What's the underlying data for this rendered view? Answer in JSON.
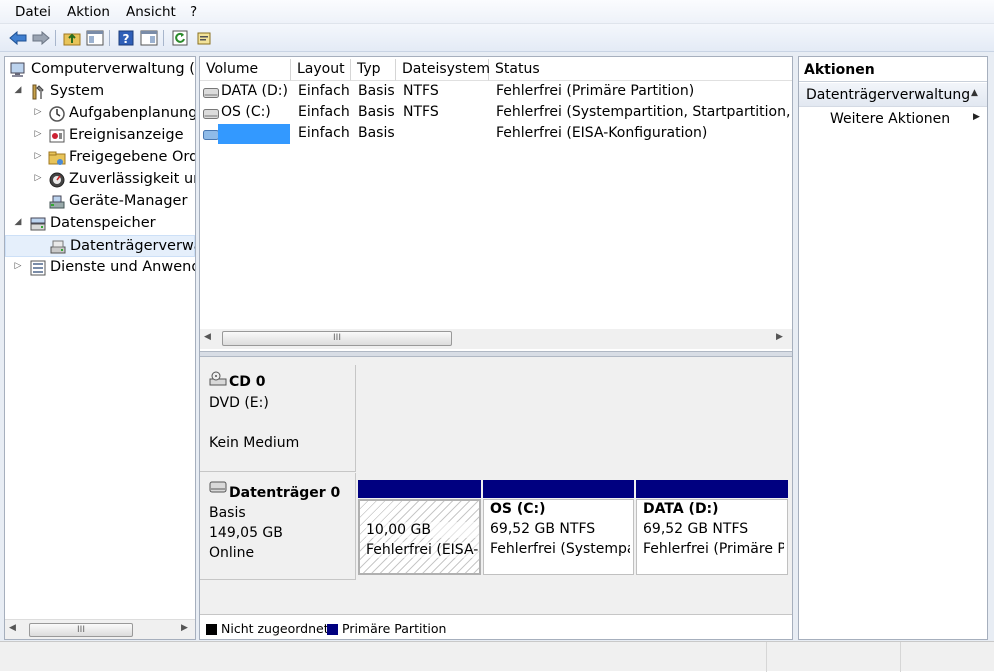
{
  "menu": [
    "Datei",
    "Aktion",
    "Ansicht",
    "?"
  ],
  "toolbar": {
    "icons": [
      "back-icon",
      "forward-icon",
      "up-folder-icon",
      "show-hide-tree-icon",
      "help-icon",
      "show-hide-action-icon",
      "refresh-icon",
      "properties-icon"
    ]
  },
  "tree": {
    "root": "Computerverwaltung (Lo",
    "system": "System",
    "aufgaben": "Aufgabenplanung",
    "ereignis": "Ereignisanzeige",
    "freigegeben": "Freigegebene Ordr",
    "zuverl": "Zuverlässigkeit unc",
    "geraete": "Geräte-Manager",
    "datenspeicher": "Datenspeicher",
    "datentraeger": "Datenträgerverwal",
    "dienste": "Dienste und Anwendu"
  },
  "list": {
    "headers": [
      "Volume",
      "Layout",
      "Typ",
      "Dateisystem",
      "Status"
    ],
    "rows": [
      {
        "volume": "DATA (D:)",
        "layout": "Einfach",
        "typ": "Basis",
        "fs": "NTFS",
        "status": "Fehlerfrei (Primäre Partition)"
      },
      {
        "volume": "OS (C:)",
        "layout": "Einfach",
        "typ": "Basis",
        "fs": "NTFS",
        "status": "Fehlerfrei (Systempartition, Startpartition, Aus"
      },
      {
        "volume": "",
        "layout": "Einfach",
        "typ": "Basis",
        "fs": "",
        "status": "Fehlerfrei (EISA-Konfiguration)"
      }
    ],
    "scroll_mark": "III"
  },
  "disks": {
    "cd": {
      "name": "CD 0",
      "type": "DVD (E:)",
      "media": "Kein Medium"
    },
    "disk0": {
      "name": "Datenträger 0",
      "type": "Basis",
      "size": "149,05 GB",
      "state": "Online"
    },
    "partitions": [
      {
        "title": "",
        "size": "10,00 GB",
        "status": "Fehlerfrei (EISA-I"
      },
      {
        "title": "OS  (C:)",
        "size": "69,52 GB NTFS",
        "status": "Fehlerfrei (Systempar"
      },
      {
        "title": "DATA  (D:)",
        "size": "69,52 GB NTFS",
        "status": "Fehlerfrei (Primäre Pa"
      }
    ]
  },
  "legend": {
    "unallocated": "Nicht zugeordnet",
    "primary": "Primäre Partition"
  },
  "actions": {
    "title": "Aktionen",
    "section": "Datenträgerverwaltung",
    "more": "Weitere Aktionen"
  },
  "tree_scroll_mark": "III",
  "colors": {
    "primary_partition": "#000080",
    "selection": "#3399ff",
    "highlight_row": "#e5effb"
  }
}
